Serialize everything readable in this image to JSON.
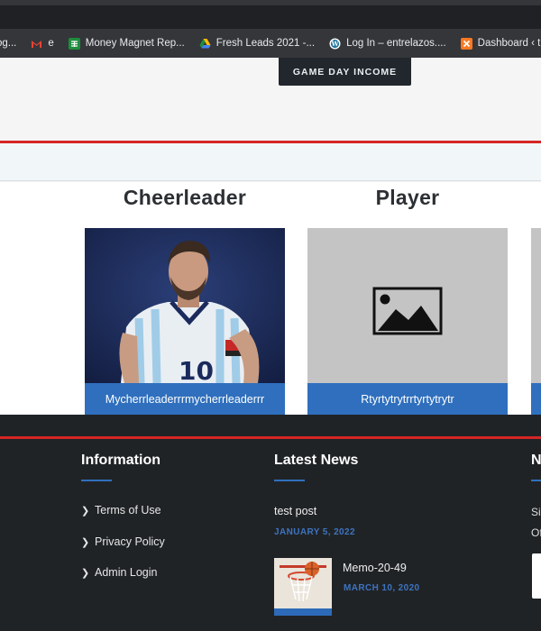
{
  "bookmarks": [
    {
      "label": "og...",
      "icon": "page-icon",
      "color": "#8ab4f8"
    },
    {
      "label": "e",
      "icon": "gmail-icon",
      "color": "#ea4335"
    },
    {
      "label": "Money Magnet Rep...",
      "icon": "sheets-icon",
      "color": "#1e8e3e"
    },
    {
      "label": "Fresh Leads 2021 -...",
      "icon": "drive-icon",
      "color": "#fbbc04"
    },
    {
      "label": "Log In – entrelazos....",
      "icon": "wordpress-icon",
      "color": "#ffffff"
    },
    {
      "label": "Dashboard ‹ travel...",
      "icon": "xampp-icon",
      "color": "#fb7a24"
    }
  ],
  "hero": {
    "cta_label": "GAME DAY INCOME"
  },
  "columns": [
    {
      "title": "Cheerleader",
      "caption": "Mycherrleaderrrmycherrleaderrr"
    },
    {
      "title": "Player",
      "caption": "Rtyrtytrytrrtyrtytrytr"
    }
  ],
  "footer": {
    "information": {
      "title": "Information",
      "links": [
        "Terms of Use",
        "Privacy Policy",
        "Admin Login"
      ]
    },
    "news": {
      "title": "Latest News",
      "items": [
        {
          "title": "test post",
          "date": "JANUARY 5, 2022"
        },
        {
          "title": "Memo-20-49",
          "date": "MARCH 10, 2020"
        }
      ]
    },
    "third": {
      "title": "N",
      "line1": "Si",
      "line2": "Of"
    }
  }
}
